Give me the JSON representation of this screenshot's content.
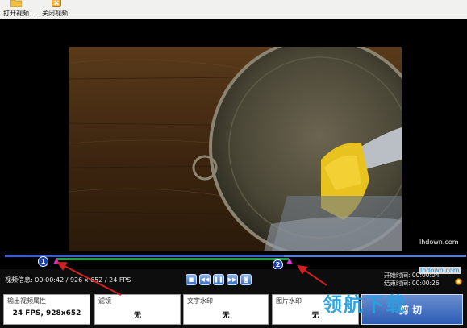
{
  "toolbar": {
    "open_label": "打开视频...",
    "close_label": "关闭视频"
  },
  "info": {
    "label": "视频信息:",
    "value": "00:00:42 / 926 x 652 / 24 FPS"
  },
  "controls": [
    "stop",
    "rewind",
    "pause",
    "forward",
    "snapshot"
  ],
  "times": {
    "start": "开始时间: 00:00:04",
    "end": "结束时间: 00:00:26"
  },
  "boxes": {
    "output_title": "输出视频属性",
    "output_value": "24 FPS, 928x652",
    "filter_title": "滤镜",
    "filter_value": "无",
    "text_wm_title": "文字水印",
    "text_wm_value": "无",
    "image_wm_title": "图片水印",
    "image_wm_value": "无"
  },
  "cut_button": "剪切",
  "markers": {
    "one": "1",
    "two": "2"
  },
  "watermark": {
    "brand": "领航下载",
    "url": "lhdown.com"
  },
  "colors": {
    "timeline_blue": "#3a5fcd",
    "timeline_green": "#1aa53a",
    "marker": "#d43ac8",
    "annotation": "#d21f1f"
  }
}
